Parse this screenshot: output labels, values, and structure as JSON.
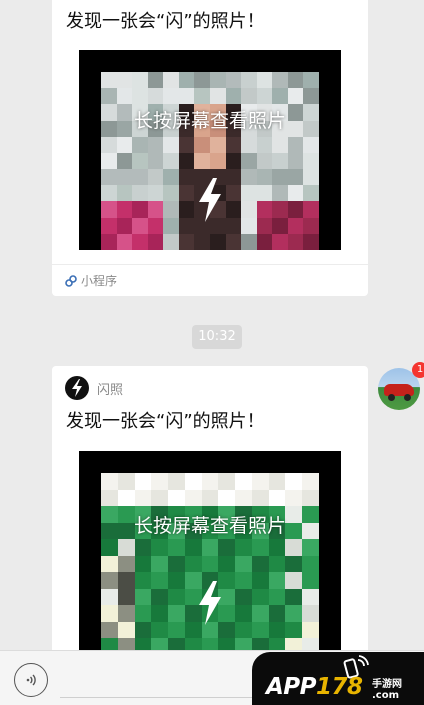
{
  "messages": [
    {
      "title": "发现一张会“闪”的照片！",
      "overlay_text": "长按屏幕查看照片",
      "footer_label": "小程序",
      "colors": [
        "#b7c5c0",
        "#dde3e2",
        "#9fb0ad",
        "#c8d0cf",
        "#e3e7e8",
        "#8d9896",
        "#cdd5d4",
        "#a9b5b3",
        "#e8ebec",
        "#b3bbbb",
        "#d6dbdb",
        "#9aa6a4",
        "#c2c9c8",
        "#e1e4e4",
        "#b0b9b8"
      ]
    },
    {
      "title": "发现一张会“闪”的照片！",
      "header_label": "闪照",
      "overlay_text": "长按屏幕查看照片",
      "colors": [
        "#1f8a45",
        "#2a9a52",
        "#17793b",
        "#3aa862",
        "#e8ece8",
        "#d8dcd6",
        "#8c8f82",
        "#f2f1d8",
        "#1a6d3a",
        "#4b4d45"
      ]
    }
  ],
  "time_badge": "10:32",
  "avatar_badge_count": "1",
  "watermark": {
    "prefix": "APP",
    "number": "178",
    "sub_top": "手游网",
    "sub_bottom": ".com"
  }
}
